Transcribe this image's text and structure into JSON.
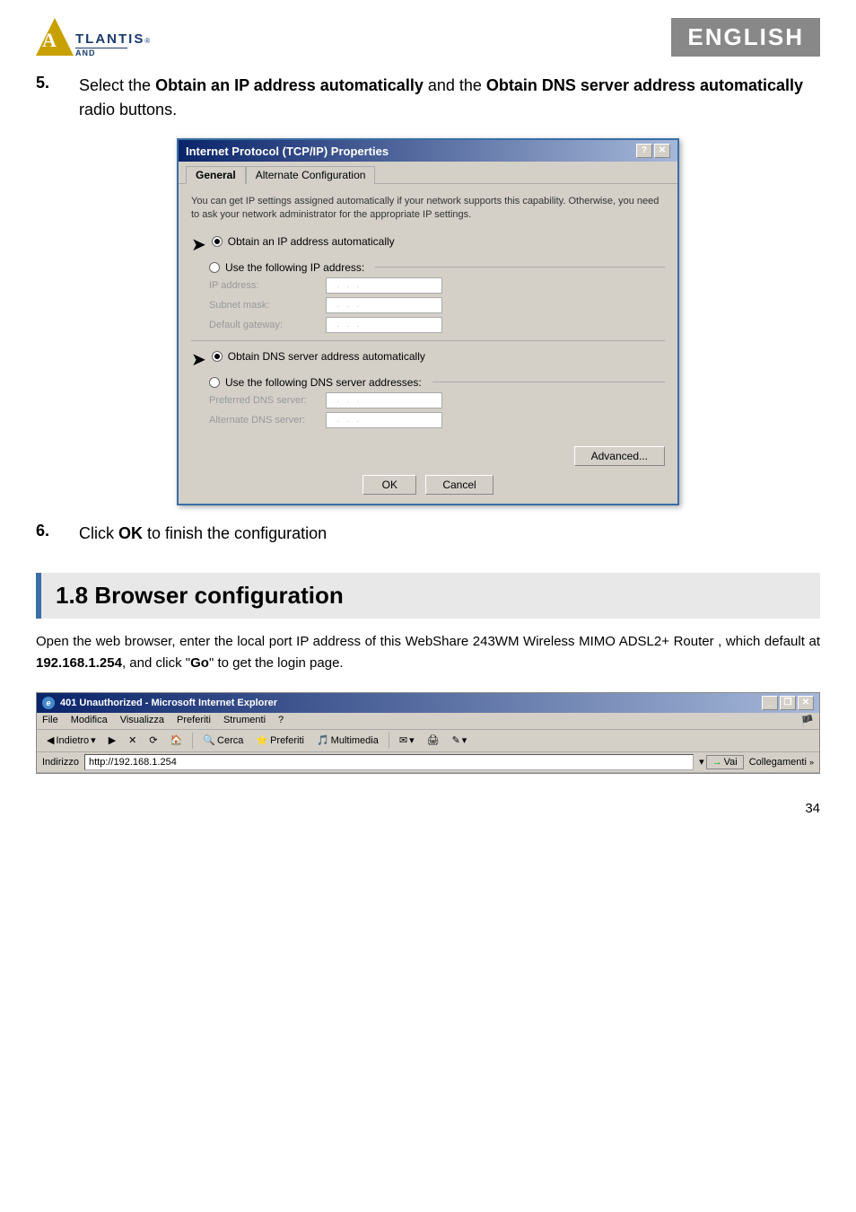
{
  "header": {
    "logo_text": "TLANTIS",
    "logo_a": "A",
    "logo_and": "AND",
    "registered": "®",
    "english_badge": "ENGLISH"
  },
  "step5": {
    "number": "5.",
    "text_before": "Select the ",
    "bold1": "Obtain an IP address automatically",
    "text_mid": " and the ",
    "bold2": "Obtain DNS server address automatically",
    "text_after": " radio buttons."
  },
  "dialog": {
    "title": "Internet Protocol (TCP/IP) Properties",
    "help_btn": "?",
    "close_btn": "✕",
    "tabs": [
      {
        "label": "General",
        "active": true
      },
      {
        "label": "Alternate Configuration",
        "active": false
      }
    ],
    "description": "You can get IP settings assigned automatically if your network supports\nthis capability. Otherwise, you need to ask your network administrator for\nthe appropriate IP settings.",
    "radio_ip_auto": "Obtain an IP address automatically",
    "radio_ip_manual": "Use the following IP address:",
    "label_ip": "IP address:",
    "label_subnet": "Subnet mask:",
    "label_gateway": "Default gateway:",
    "radio_dns_auto": "Obtain DNS server address automatically",
    "radio_dns_manual": "Use the following DNS server addresses:",
    "label_pref_dns": "Preferred DNS server:",
    "label_alt_dns": "Alternate DNS server:",
    "advanced_btn": "Advanced...",
    "ok_btn": "OK",
    "cancel_btn": "Cancel"
  },
  "step6": {
    "number": "6.",
    "text": "Click ",
    "bold": "OK",
    "text2": " to finish the configuration"
  },
  "section18": {
    "heading": "1.8 Browser configuration",
    "description_parts": [
      "Open the web browser, enter the local port IP address of this WebShare 243WM Wireless MIMO ADSL2+ Router , which default at ",
      "192.168.1.254",
      ", and click \"",
      "Go",
      "\" to get the login page."
    ]
  },
  "browser": {
    "title": "401 Unauthorized - Microsoft Internet Explorer",
    "menu": [
      "File",
      "Modifica",
      "Visualizza",
      "Preferiti",
      "Strumenti",
      "?"
    ],
    "toolbar_buttons": [
      "Indietro",
      "Avanti",
      "Stop",
      "Aggiorna",
      "Home",
      "Cerca",
      "Preferiti",
      "Multimedia"
    ],
    "address_label": "Indirizzo",
    "address_value": "http://192.168.1.254",
    "go_label": "Vai",
    "links_label": "Collegamenti"
  },
  "page_number": "34"
}
